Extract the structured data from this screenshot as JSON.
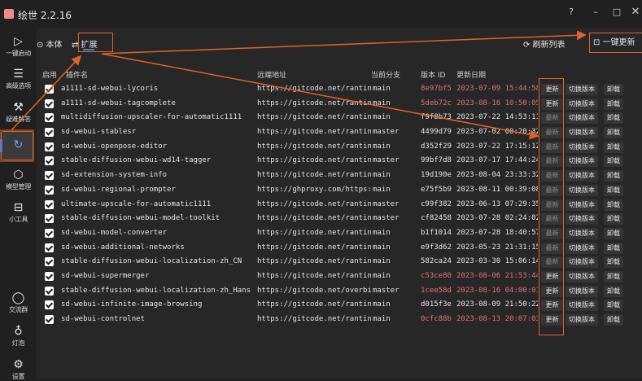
{
  "app": {
    "title": "绘世 2.2.16"
  },
  "window_controls": {
    "help": "?",
    "minimize": "–",
    "maximize": "□",
    "close": "✕"
  },
  "sidebar": {
    "items": [
      {
        "label": "一键启动",
        "icon": "play-icon",
        "glyph": "▷"
      },
      {
        "label": "高级选项",
        "icon": "sliders-icon",
        "glyph": "☰"
      },
      {
        "label": "疑难解答",
        "icon": "troubleshoot-icon",
        "glyph": "⚒"
      },
      {
        "label": "",
        "icon": "history-icon",
        "glyph": "↻"
      },
      {
        "label": "模型管理",
        "icon": "cube-icon",
        "glyph": "⬡"
      },
      {
        "label": "小工具",
        "icon": "toolbox-icon",
        "glyph": "⊟"
      },
      {
        "label": "交流群",
        "icon": "chat-icon",
        "glyph": "◯"
      },
      {
        "label": "灯泡",
        "icon": "bulb-icon",
        "glyph": "♁"
      },
      {
        "label": "设置",
        "icon": "gear-icon",
        "glyph": "⚙"
      }
    ]
  },
  "tabs": {
    "local": "⊙ 本体",
    "extensions": "⇄ 扩展"
  },
  "toolbar": {
    "refresh": "⟳  刷新列表",
    "update_all": "⊡  一键更新"
  },
  "table": {
    "headers": {
      "enabled": "启用",
      "name": "插件名",
      "url": "远端地址",
      "branch": "当前分支",
      "version_id": "版本 ID",
      "updated": "更新日期"
    },
    "labels": {
      "update": "更新",
      "latest": "最新",
      "switch": "切换版本",
      "uninstall": "卸载"
    },
    "rows": [
      {
        "name": "a1111-sd-webui-lycoris",
        "url": "https://gitcode.net/ranting",
        "branch": "main",
        "id": "8e97bf5",
        "date": "2023-07-09 15:44:58",
        "status": "更新",
        "id_color": "#e0707a"
      },
      {
        "name": "a1111-sd-webui-tagcomplete",
        "url": "https://gitcode.net/ranting",
        "branch": "main",
        "id": "5deb72c",
        "date": "2023-08-16 10:50:05",
        "status": "更新",
        "id_color": "#e0707a"
      },
      {
        "name": "multidiffusion-upscaler-for-automatic1111",
        "url": "https://gitcode.net/ranting",
        "branch": "main",
        "id": "f9f8b73",
        "date": "2023-07-22 14:53:11",
        "status": "最新",
        "id_color": "#e4e4e4"
      },
      {
        "name": "sd-webui-stablesr",
        "url": "https://gitcode.net/ranting",
        "branch": "master",
        "id": "4499d79",
        "date": "2023-07-02 00:20:32",
        "status": "最新",
        "id_color": "#e4e4e4"
      },
      {
        "name": "sd-webui-openpose-editor",
        "url": "https://gitcode.net/ranting",
        "branch": "main",
        "id": "d352f29",
        "date": "2023-07-22 17:15:12",
        "status": "最新",
        "id_color": "#e4e4e4"
      },
      {
        "name": "stable-diffusion-webui-wd14-tagger",
        "url": "https://gitcode.net/ranting",
        "branch": "master",
        "id": "99bf7d8",
        "date": "2023-07-17 17:44:24",
        "status": "最新",
        "id_color": "#e4e4e4"
      },
      {
        "name": "sd-extension-system-info",
        "url": "https://gitcode.net/ranting",
        "branch": "main",
        "id": "19d190e",
        "date": "2023-08-04 23:33:32",
        "status": "最新",
        "id_color": "#e4e4e4"
      },
      {
        "name": "sd-webui-regional-prompter",
        "url": "https://ghproxy.com/https:/",
        "branch": "main",
        "id": "e75f5b9",
        "date": "2023-08-11 00:39:08",
        "status": "最新",
        "id_color": "#e4e4e4"
      },
      {
        "name": "ultimate-upscale-for-automatic1111",
        "url": "https://gitcode.net/ranting",
        "branch": "master",
        "id": "c99f382",
        "date": "2023-06-13 07:29:35",
        "status": "最新",
        "id_color": "#e4e4e4"
      },
      {
        "name": "stable-diffusion-webui-model-toolkit",
        "url": "https://gitcode.net/ranting",
        "branch": "master",
        "id": "cf82458",
        "date": "2023-07-28 02:24:02",
        "status": "最新",
        "id_color": "#e4e4e4"
      },
      {
        "name": "sd-webui-model-converter",
        "url": "https://gitcode.net/ranting",
        "branch": "main",
        "id": "b1f1014",
        "date": "2023-07-28 18:40:57",
        "status": "最新",
        "id_color": "#e4e4e4"
      },
      {
        "name": "sd-webui-additional-networks",
        "url": "https://gitcode.net/ranting",
        "branch": "main",
        "id": "e9f3d62",
        "date": "2023-05-23 21:31:15",
        "status": "最新",
        "id_color": "#e4e4e4"
      },
      {
        "name": "stable-diffusion-webui-localization-zh_CN",
        "url": "https://gitcode.net/ranting",
        "branch": "main",
        "id": "582ca24",
        "date": "2023-03-30 15:06:14",
        "status": "最新",
        "id_color": "#e4e4e4"
      },
      {
        "name": "sd-webui-supermerger",
        "url": "https://gitcode.net/ranting",
        "branch": "main",
        "id": "c53ce80",
        "date": "2023-08-06 21:53:44",
        "status": "更新",
        "id_color": "#e0707a"
      },
      {
        "name": "stable-diffusion-webui-localization-zh_Hans",
        "url": "https://gitcode.net/overbil",
        "branch": "master",
        "id": "1cee58d",
        "date": "2023-08-16 04:00:01",
        "status": "更新",
        "id_color": "#e0707a"
      },
      {
        "name": "sd-webui-infinite-image-browsing",
        "url": "https://gitcode.net/ranting",
        "branch": "main",
        "id": "d015f3e",
        "date": "2023-08-09 21:50:22",
        "status": "更新",
        "id_color": "#e4e4e4"
      },
      {
        "name": "sd-webui-controlnet",
        "url": "https://gitcode.net/ranting",
        "branch": "main",
        "id": "0cfc88b",
        "date": "2023-08-13 20:07:03",
        "status": "更新",
        "id_color": "#e0707a"
      }
    ]
  },
  "colors": {
    "accent": "#3b82d6",
    "annotation": "#e0622a",
    "date_red": "#e0707a"
  }
}
